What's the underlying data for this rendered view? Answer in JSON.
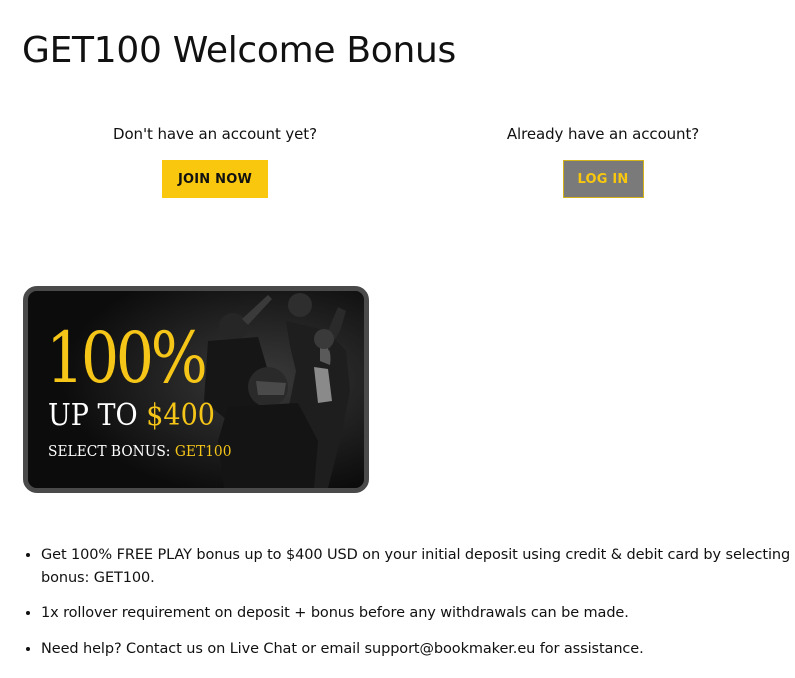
{
  "page": {
    "title": "GET100 Welcome Bonus"
  },
  "signup": {
    "prompt": "Don't have an account yet?",
    "button_label": "JOIN NOW"
  },
  "login": {
    "prompt": "Already have an account?",
    "button_label": "LOG IN"
  },
  "banner": {
    "headline": "100%",
    "upto_label": "UP TO",
    "upto_amount": "$400",
    "select_label": "SELECT BONUS:",
    "select_code": "GET100",
    "colors": {
      "gold": "#f5c518",
      "frame": "#4a4a4a",
      "background": "#0c0c0c"
    }
  },
  "bullets": [
    "Get 100% FREE PLAY bonus up to $400 USD on your initial deposit using credit & debit card by selecting bonus: GET100.",
    "1x rollover requirement on deposit + bonus before any withdrawals can be made.",
    "Need help? Contact us on Live Chat or email support@bookmaker.eu for assistance."
  ],
  "colors": {
    "join_button": "#f9c80e",
    "login_button_bg": "#7a7a7a",
    "login_button_text": "#f9c80e"
  }
}
